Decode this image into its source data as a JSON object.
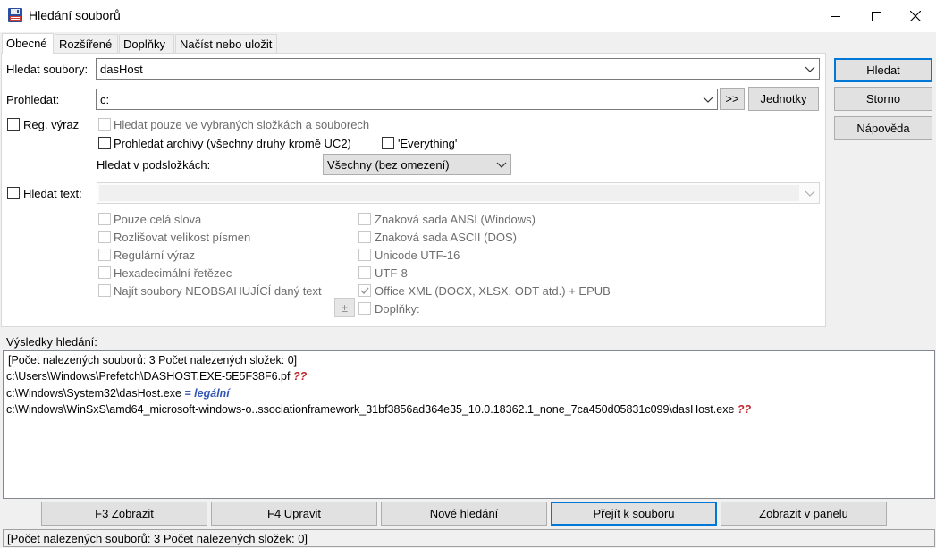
{
  "window": {
    "title": "Hledání souborů",
    "minimize_icon": "minimize-icon",
    "maximize_icon": "maximize-icon",
    "close_icon": "close-icon"
  },
  "tabs": [
    {
      "label": "Obecné",
      "active": true
    },
    {
      "label": "Rozšířené",
      "active": false
    },
    {
      "label": "Doplňky",
      "active": false
    },
    {
      "label": "Načíst nebo uložit",
      "active": false
    }
  ],
  "search": {
    "files_label": "Hledat soubory:",
    "files_value": "dasHost",
    "browse_label": "Prohledat:",
    "browse_value": "c:",
    "more_label": ">>",
    "drives_label": "Jednotky",
    "regex_label": "Reg. výraz",
    "only_selected_label": "Hledat pouze ve vybraných složkách a souborech",
    "archives_label": "Prohledat archivy (všechny druhy kromě UC2)",
    "everything_label": "'Everything'",
    "subfolders_label": "Hledat v podsložkách:",
    "subfolders_value": "Všechny (bez omezení)"
  },
  "text_search": {
    "label": "Hledat text:",
    "value": "",
    "options_left": [
      "Pouze celá slova",
      "Rozlišovat velikost písmen",
      "Regulární výraz",
      "Hexadecimální řetězec",
      "Najít soubory NEOBSAHUJÍCÍ daný text"
    ],
    "options_right": [
      {
        "label": "Znaková sada ANSI (Windows)",
        "checked": false
      },
      {
        "label": "Znaková sada ASCII (DOS)",
        "checked": false
      },
      {
        "label": "Unicode UTF-16",
        "checked": false
      },
      {
        "label": "UTF-8",
        "checked": false
      },
      {
        "label": "Office XML (DOCX, XLSX, ODT atd.) + EPUB",
        "checked": true
      },
      {
        "label": "Doplňky:",
        "checked": false
      }
    ],
    "plusminus_label": "±"
  },
  "side_buttons": {
    "search": "Hledat",
    "cancel": "Storno",
    "help": "Nápověda"
  },
  "results": {
    "title": "Výsledky hledání:",
    "summary": "[Počet nalezených souborů: 3  Počet nalezených složek: 0]",
    "rows": [
      {
        "path": "c:\\Users\\Windows\\Prefetch\\DASHOST.EXE-5E5F38F6.pf",
        "tag": "??",
        "kind": "unknown"
      },
      {
        "path": "c:\\Windows\\System32\\dasHost.exe",
        "tag": "= legální",
        "kind": "legal"
      },
      {
        "path": "c:\\Windows\\WinSxS\\amd64_microsoft-windows-o..ssociationframework_31bf3856ad364e35_10.0.18362.1_none_7ca450d05831c099\\dasHost.exe",
        "tag": "??",
        "kind": "unknown"
      }
    ]
  },
  "bottom_buttons": {
    "view": "F3 Zobrazit",
    "edit": "F4 Upravit",
    "new_search": "Nové hledání",
    "goto_file": "Přejít k souboru",
    "feed_to_panel": "Zobrazit v panelu"
  },
  "status": {
    "text": "[Počet nalezených souborů: 3  Počet nalezených složek: 0]"
  }
}
